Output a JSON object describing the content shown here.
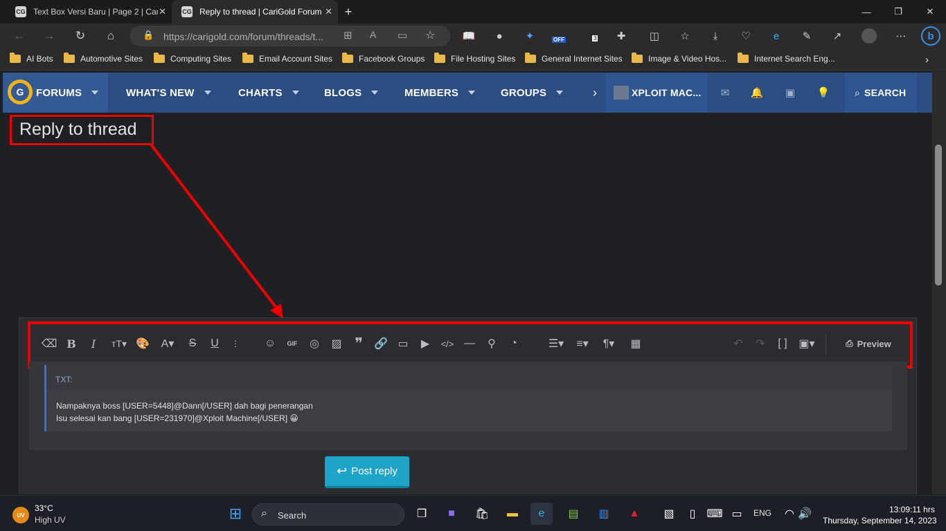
{
  "tabs": [
    {
      "title": "Text Box Versi Baru | Page 2 | Cari",
      "favicon": "CG"
    },
    {
      "title": "Reply to thread | CariGold Forum",
      "favicon": "CG"
    }
  ],
  "address": {
    "url": "https://carigold.com/forum/threads/t..."
  },
  "bookmarks": [
    "AI Bots",
    "Automotive Sites",
    "Computing Sites",
    "Email Account Sites",
    "Facebook Groups",
    "File Hosting Sites",
    "General Internet Sites",
    "Image & Video Hos...",
    "Internet Search Eng..."
  ],
  "extensions": {
    "off_badge": "OFF",
    "count_badge": "3"
  },
  "nav": {
    "logo": "G",
    "items": [
      "FORUMS",
      "WHAT'S NEW",
      "CHARTS",
      "BLOGS",
      "MEMBERS",
      "GROUPS"
    ],
    "user": "XPLOIT MAC...",
    "search": "SEARCH"
  },
  "page": {
    "title": "Reply to thread"
  },
  "editor": {
    "quote_label": "TXT:",
    "lines": [
      "Nampaknya boss [USER=5448]@Dann[/USER] dah bagi penerangan",
      "Isu selesai kan bang [USER=231970]@Xploit Machine[/USER] 😀"
    ],
    "preview": "Preview",
    "gif": "GIF"
  },
  "post_button": "Post reply",
  "taskbar": {
    "weather_temp": "33°C",
    "weather_desc": "High UV",
    "weather_badge": "UV",
    "search": "Search",
    "lang": "ENG",
    "time": "13:09:11 hrs",
    "date": "Thursday, September 14, 2023"
  },
  "colors": {
    "nav": "#2c4d82",
    "highlight": "#e00000",
    "post_button": "#1ea3c9"
  }
}
